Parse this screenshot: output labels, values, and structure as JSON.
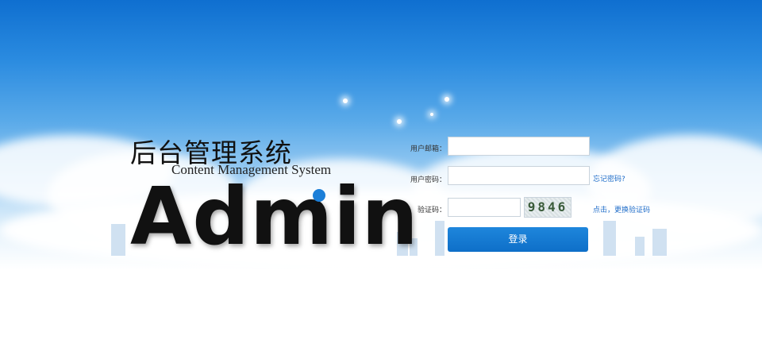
{
  "brand": {
    "title_cn": "后台管理系统",
    "subtitle_en": "Content Management System",
    "logo_text": "Admin"
  },
  "login_form": {
    "email_label": "用户邮箱：",
    "email_value": "",
    "password_label": "用户密码：",
    "password_value": "",
    "forgot_password_link": "忘记密码?",
    "captcha_label": "验证码：",
    "captcha_value": "",
    "captcha_image_text": "9846",
    "refresh_captcha_link": "点击，更换验证码",
    "submit_label": "登录"
  },
  "colors": {
    "accent": "#1c7fd8",
    "button": "#1478d0",
    "link": "#1f6dc9"
  }
}
